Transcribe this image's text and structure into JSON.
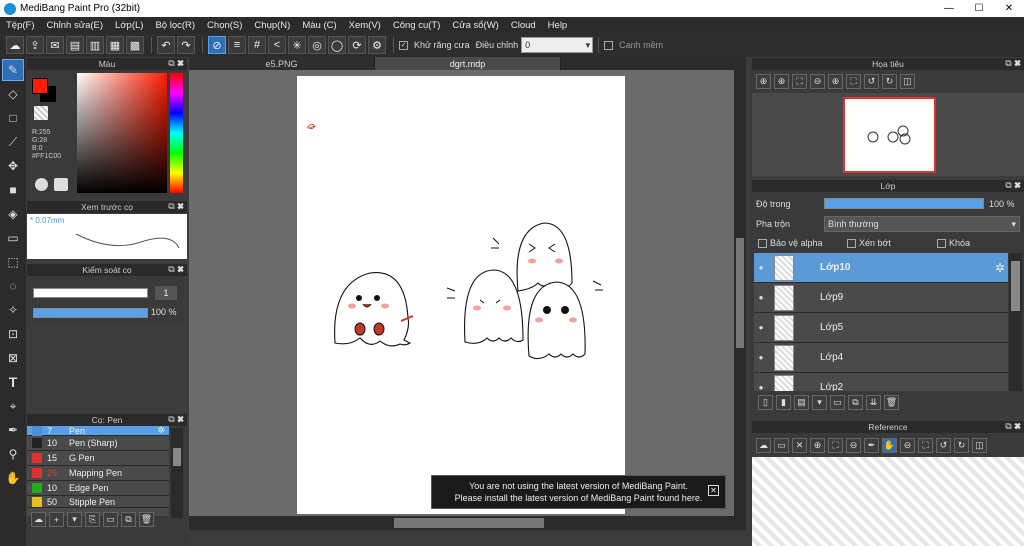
{
  "title": "MediBang Paint Pro (32bit)",
  "window_buttons": [
    "—",
    "☐",
    "✕"
  ],
  "menu": [
    "Tệp(F)",
    "Chỉnh sửa(E)",
    "Lớp(L)",
    "Bộ lọc(R)",
    "Chọn(S)",
    "Chụp(N)",
    "Màu (C)",
    "Xem(V)",
    "Công cụ(T)",
    "Cửa sổ(W)",
    "Cloud",
    "Help"
  ],
  "toolbar": {
    "antialias_label": "Khử răng cưa",
    "adjust_label": "Điều chỉnh",
    "adjust_value": "0",
    "smooth_label": "Canh mềm"
  },
  "color_panel": {
    "title": "Màu",
    "r": "R:255",
    "g": "G:28",
    "b": "B:0",
    "hex": "#FF1C00",
    "primary": "#FF1C00"
  },
  "brush_preview": {
    "title": "Xem trước cọ",
    "size": "* 0.07mm"
  },
  "brush_control": {
    "title": "Kiểm soát cọ",
    "size_value": "1",
    "opacity_value": "100 %",
    "opacity": 1.0
  },
  "brush_panel": {
    "title": "Cọ: Pen",
    "items": [
      {
        "size": "7",
        "name": "Pen",
        "color": "#4a90d9"
      },
      {
        "size": "10",
        "name": "Pen (Sharp)",
        "color": "#222222"
      },
      {
        "size": "15",
        "name": "G Pen",
        "color": "#e03030"
      },
      {
        "size": "29",
        "name": "Mapping Pen",
        "color": "#e03030"
      },
      {
        "size": "10",
        "name": "Edge Pen",
        "color": "#22aa22"
      },
      {
        "size": "50",
        "name": "Stipple Pen",
        "color": "#e8c020"
      }
    ]
  },
  "tabs": [
    "e5.PNG",
    "dgrt.mdp"
  ],
  "navigator": {
    "title": "Họa tiêu"
  },
  "layer_panel": {
    "title": "Lớp",
    "opacity_label": "Độ trong",
    "opacity_value": "100 %",
    "opacity": 1.0,
    "blend_label": "Pha trộn",
    "blend_value": "Bình thường",
    "protect_alpha": "Bảo vệ alpha",
    "clipping": "Xén bớt",
    "lock": "Khóa",
    "layers": [
      "Lớp10",
      "Lớp9",
      "Lớp5",
      "Lớp4",
      "Lớp2"
    ]
  },
  "reference": {
    "title": "Reference"
  },
  "notification": {
    "line1": "You are not using the latest version of MediBang Paint.",
    "line2": "Please install the latest version of MediBang Paint found here.",
    "close": "✕"
  }
}
